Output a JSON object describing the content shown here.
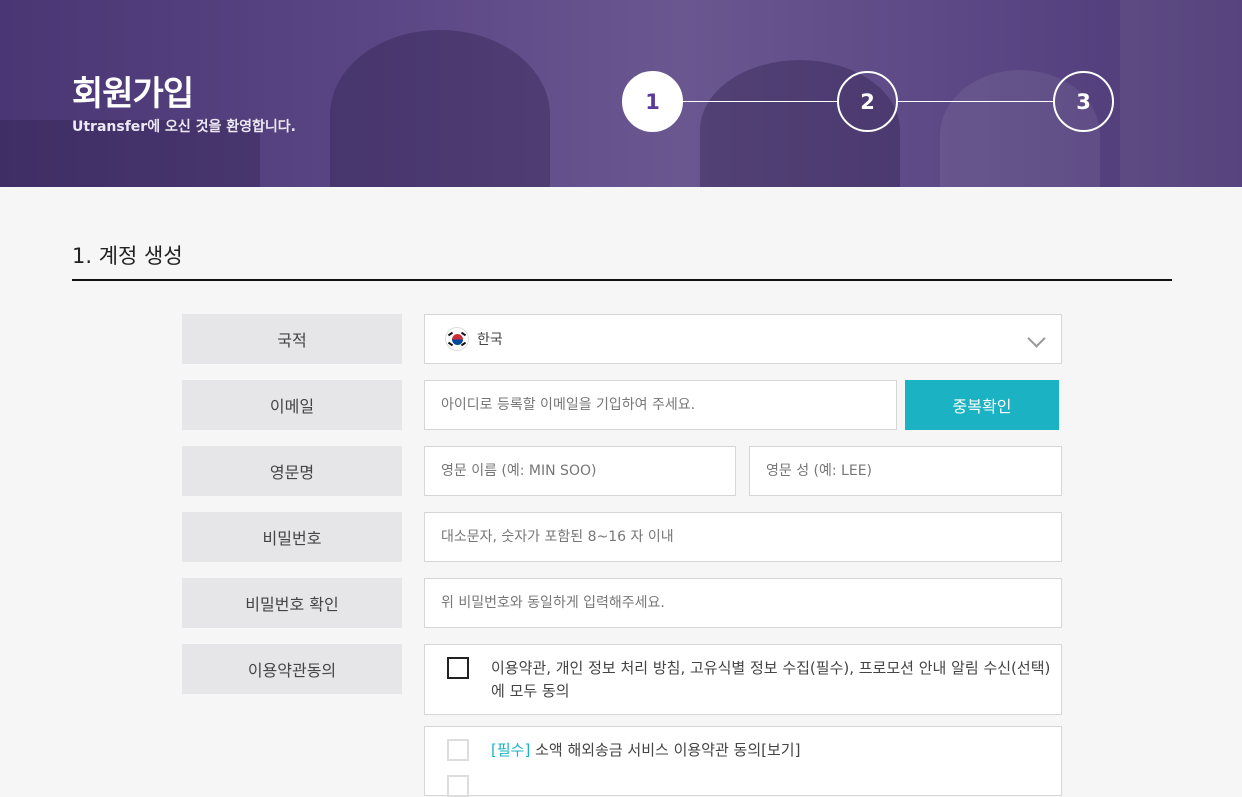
{
  "header": {
    "title": "회원가입",
    "subtitle": "Utransfer에 오신 것을 환영합니다.",
    "steps": [
      "1",
      "2",
      "3"
    ],
    "active_step": 1
  },
  "section": {
    "title": "1. 계정 생성"
  },
  "form": {
    "nationality": {
      "label": "국적",
      "value": "한국",
      "flag_icon": "korea-flag-icon"
    },
    "email": {
      "label": "이메일",
      "placeholder": "아이디로 등록할 이메일을 기입하여 주세요.",
      "button": "중복확인"
    },
    "english_name": {
      "label": "영문명",
      "first_placeholder": "영문 이름 (예: MIN SOO)",
      "last_placeholder": "영문 성 (예: LEE)"
    },
    "password": {
      "label": "비밀번호",
      "placeholder": "대소문자, 숫자가 포함된 8~16 자 이내"
    },
    "password_confirm": {
      "label": "비밀번호 확인",
      "placeholder": "위 비밀번호와 동일하게 입력해주세요."
    },
    "terms": {
      "label": "이용약관동의",
      "all_agree_text": "이용약관, 개인 정보 처리 방침, 고유식별 정보 수집(필수), 프로모션 안내 알림 수신(선택)에 모두 동의",
      "items": [
        {
          "tag": "[필수]",
          "text": " 소액 해외송금 서비스 이용약관 동의",
          "link": "[보기]"
        }
      ]
    }
  },
  "colors": {
    "accent": "#1bb3c3",
    "hero": "#5b4685",
    "step_active_text": "#5b3b9a"
  }
}
